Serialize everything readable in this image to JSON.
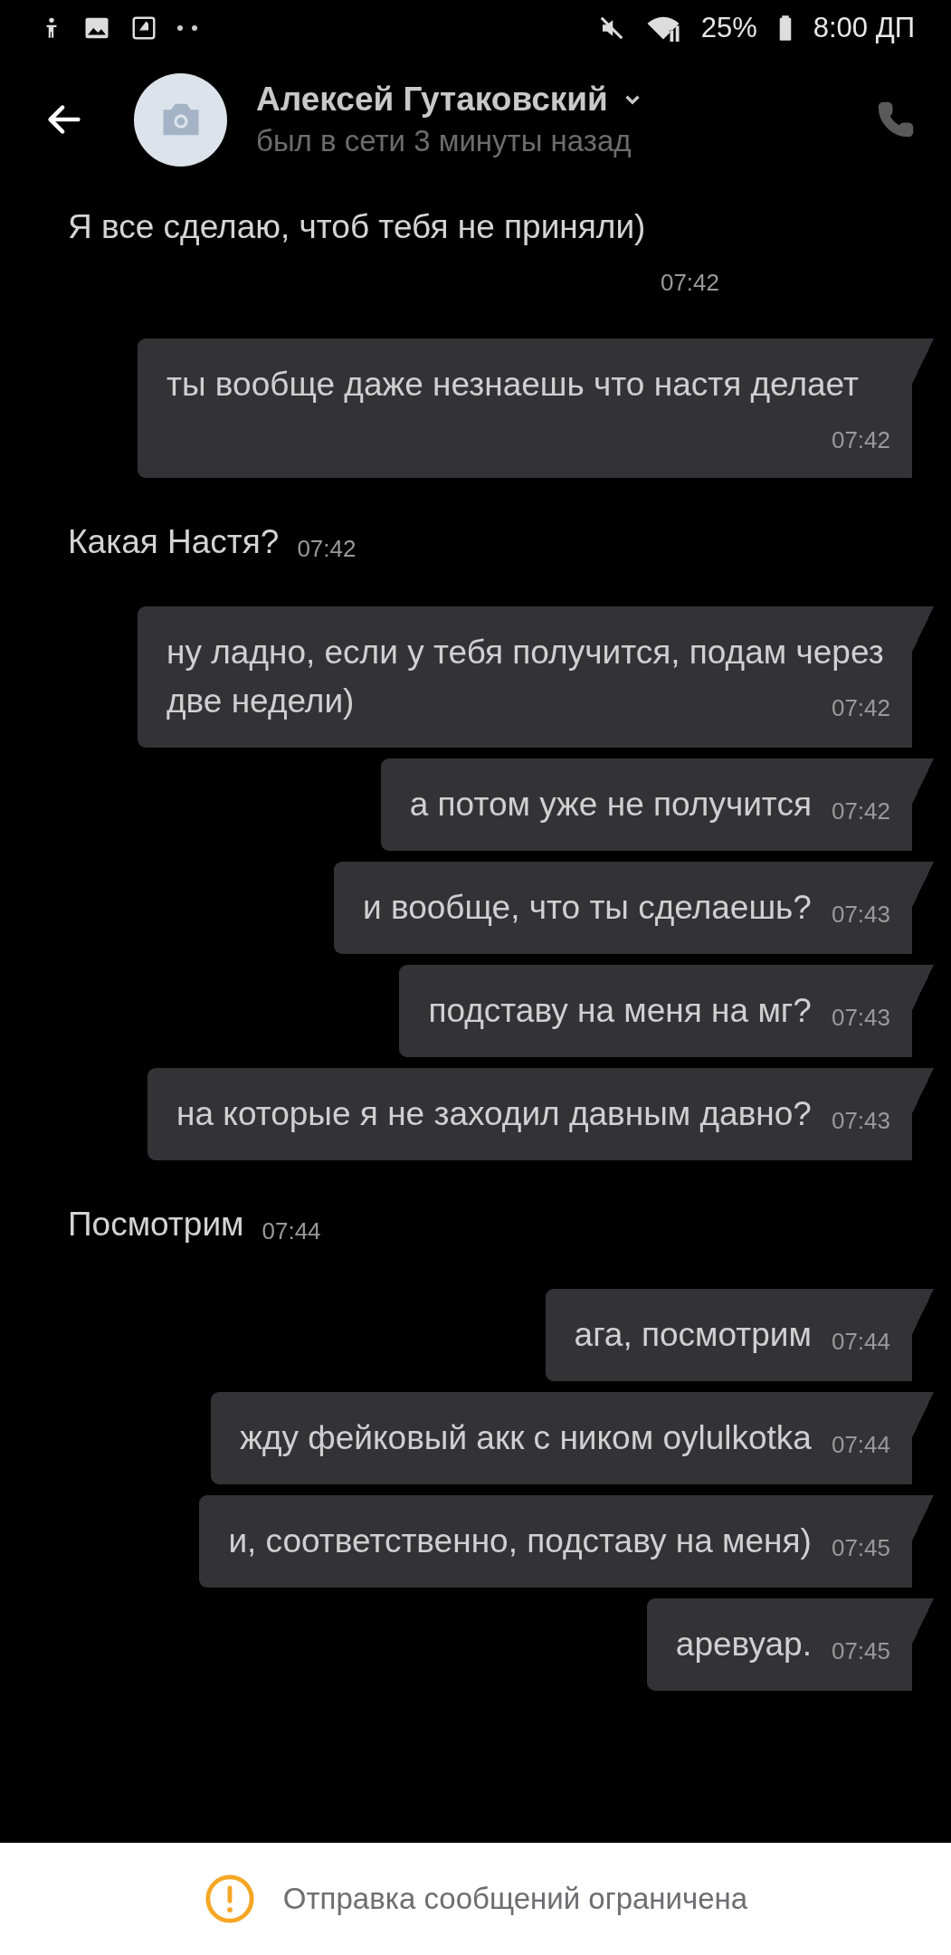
{
  "status_bar": {
    "battery": "25%",
    "time": "8:00 ДП"
  },
  "header": {
    "name": "Алексей Гутаковский",
    "last_seen": "был в сети 3 минуты назад"
  },
  "messages": [
    {
      "kind": "incoming",
      "text": "Я все сделаю, чтоб тебя не приняли)",
      "time": "07:42"
    },
    {
      "kind": "outgoing",
      "text": "ты вообще даже незнаешь что настя делает",
      "time": "07:42"
    },
    {
      "kind": "incoming",
      "text": "Какая Настя?",
      "time": "07:42"
    },
    {
      "kind": "outgoing",
      "text": "ну ладно, если у тебя получится, подам через две недели)",
      "time": "07:42"
    },
    {
      "kind": "outgoing",
      "text": "а потом уже не получится",
      "time": "07:42"
    },
    {
      "kind": "outgoing",
      "text": "и вообще, что ты сделаешь?",
      "time": "07:43"
    },
    {
      "kind": "outgoing",
      "text": "подставу на меня на мг?",
      "time": "07:43"
    },
    {
      "kind": "outgoing",
      "text": "на которые я не заходил давным давно?",
      "time": "07:43"
    },
    {
      "kind": "incoming",
      "text": "Посмотрим",
      "time": "07:44"
    },
    {
      "kind": "outgoing",
      "text": "ага, посмотрим",
      "time": "07:44"
    },
    {
      "kind": "outgoing",
      "text": "жду фейковый акк с ником oylulkotka",
      "time": "07:44"
    },
    {
      "kind": "outgoing",
      "text": "и, соответственно, подставу на меня)",
      "time": "07:45"
    },
    {
      "kind": "outgoing",
      "text": "аревуар.",
      "time": "07:45"
    }
  ],
  "notice": "Отправка сообщений ограничена"
}
